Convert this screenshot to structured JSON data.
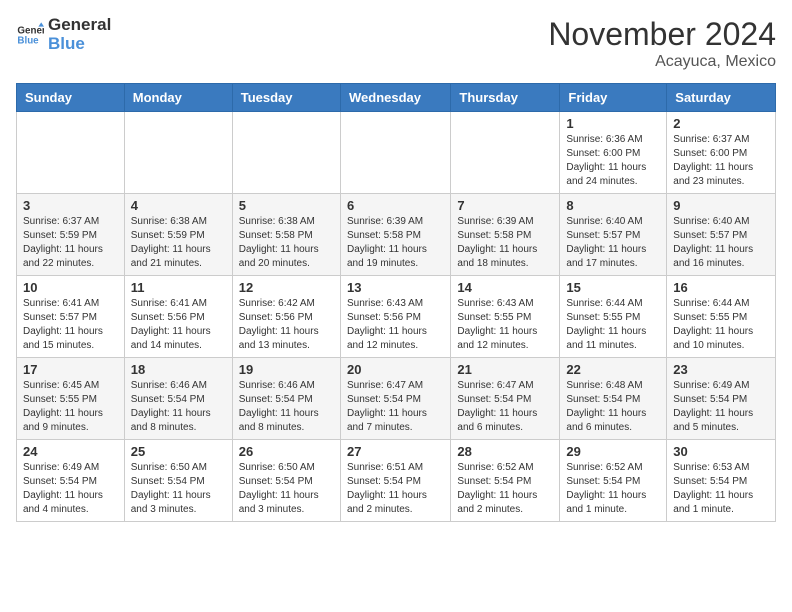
{
  "header": {
    "logo": {
      "general": "General",
      "blue": "Blue"
    },
    "month": "November 2024",
    "location": "Acayuca, Mexico"
  },
  "weekdays": [
    "Sunday",
    "Monday",
    "Tuesday",
    "Wednesday",
    "Thursday",
    "Friday",
    "Saturday"
  ],
  "weeks": [
    [
      {
        "day": "",
        "info": ""
      },
      {
        "day": "",
        "info": ""
      },
      {
        "day": "",
        "info": ""
      },
      {
        "day": "",
        "info": ""
      },
      {
        "day": "",
        "info": ""
      },
      {
        "day": "1",
        "info": "Sunrise: 6:36 AM\nSunset: 6:00 PM\nDaylight: 11 hours and 24 minutes."
      },
      {
        "day": "2",
        "info": "Sunrise: 6:37 AM\nSunset: 6:00 PM\nDaylight: 11 hours and 23 minutes."
      }
    ],
    [
      {
        "day": "3",
        "info": "Sunrise: 6:37 AM\nSunset: 5:59 PM\nDaylight: 11 hours and 22 minutes."
      },
      {
        "day": "4",
        "info": "Sunrise: 6:38 AM\nSunset: 5:59 PM\nDaylight: 11 hours and 21 minutes."
      },
      {
        "day": "5",
        "info": "Sunrise: 6:38 AM\nSunset: 5:58 PM\nDaylight: 11 hours and 20 minutes."
      },
      {
        "day": "6",
        "info": "Sunrise: 6:39 AM\nSunset: 5:58 PM\nDaylight: 11 hours and 19 minutes."
      },
      {
        "day": "7",
        "info": "Sunrise: 6:39 AM\nSunset: 5:58 PM\nDaylight: 11 hours and 18 minutes."
      },
      {
        "day": "8",
        "info": "Sunrise: 6:40 AM\nSunset: 5:57 PM\nDaylight: 11 hours and 17 minutes."
      },
      {
        "day": "9",
        "info": "Sunrise: 6:40 AM\nSunset: 5:57 PM\nDaylight: 11 hours and 16 minutes."
      }
    ],
    [
      {
        "day": "10",
        "info": "Sunrise: 6:41 AM\nSunset: 5:57 PM\nDaylight: 11 hours and 15 minutes."
      },
      {
        "day": "11",
        "info": "Sunrise: 6:41 AM\nSunset: 5:56 PM\nDaylight: 11 hours and 14 minutes."
      },
      {
        "day": "12",
        "info": "Sunrise: 6:42 AM\nSunset: 5:56 PM\nDaylight: 11 hours and 13 minutes."
      },
      {
        "day": "13",
        "info": "Sunrise: 6:43 AM\nSunset: 5:56 PM\nDaylight: 11 hours and 12 minutes."
      },
      {
        "day": "14",
        "info": "Sunrise: 6:43 AM\nSunset: 5:55 PM\nDaylight: 11 hours and 12 minutes."
      },
      {
        "day": "15",
        "info": "Sunrise: 6:44 AM\nSunset: 5:55 PM\nDaylight: 11 hours and 11 minutes."
      },
      {
        "day": "16",
        "info": "Sunrise: 6:44 AM\nSunset: 5:55 PM\nDaylight: 11 hours and 10 minutes."
      }
    ],
    [
      {
        "day": "17",
        "info": "Sunrise: 6:45 AM\nSunset: 5:55 PM\nDaylight: 11 hours and 9 minutes."
      },
      {
        "day": "18",
        "info": "Sunrise: 6:46 AM\nSunset: 5:54 PM\nDaylight: 11 hours and 8 minutes."
      },
      {
        "day": "19",
        "info": "Sunrise: 6:46 AM\nSunset: 5:54 PM\nDaylight: 11 hours and 8 minutes."
      },
      {
        "day": "20",
        "info": "Sunrise: 6:47 AM\nSunset: 5:54 PM\nDaylight: 11 hours and 7 minutes."
      },
      {
        "day": "21",
        "info": "Sunrise: 6:47 AM\nSunset: 5:54 PM\nDaylight: 11 hours and 6 minutes."
      },
      {
        "day": "22",
        "info": "Sunrise: 6:48 AM\nSunset: 5:54 PM\nDaylight: 11 hours and 6 minutes."
      },
      {
        "day": "23",
        "info": "Sunrise: 6:49 AM\nSunset: 5:54 PM\nDaylight: 11 hours and 5 minutes."
      }
    ],
    [
      {
        "day": "24",
        "info": "Sunrise: 6:49 AM\nSunset: 5:54 PM\nDaylight: 11 hours and 4 minutes."
      },
      {
        "day": "25",
        "info": "Sunrise: 6:50 AM\nSunset: 5:54 PM\nDaylight: 11 hours and 3 minutes."
      },
      {
        "day": "26",
        "info": "Sunrise: 6:50 AM\nSunset: 5:54 PM\nDaylight: 11 hours and 3 minutes."
      },
      {
        "day": "27",
        "info": "Sunrise: 6:51 AM\nSunset: 5:54 PM\nDaylight: 11 hours and 2 minutes."
      },
      {
        "day": "28",
        "info": "Sunrise: 6:52 AM\nSunset: 5:54 PM\nDaylight: 11 hours and 2 minutes."
      },
      {
        "day": "29",
        "info": "Sunrise: 6:52 AM\nSunset: 5:54 PM\nDaylight: 11 hours and 1 minute."
      },
      {
        "day": "30",
        "info": "Sunrise: 6:53 AM\nSunset: 5:54 PM\nDaylight: 11 hours and 1 minute."
      }
    ]
  ]
}
